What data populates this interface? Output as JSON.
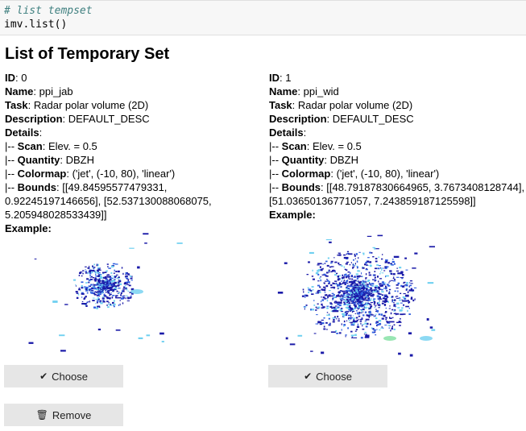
{
  "code": {
    "comment": "# list tempset",
    "call": "imv.list()"
  },
  "heading": "List of Temporary Set",
  "sets": [
    {
      "id_label": "ID",
      "id": "0",
      "name_label": "Name",
      "name": "ppi_jab",
      "task_label": "Task",
      "task": "Radar polar volume (2D)",
      "description_label": "Description",
      "description": "DEFAULT_DESC",
      "details_label": "Details",
      "scan_label": "Scan",
      "scan": "Elev. = 0.5",
      "quantity_label": "Quantity",
      "quantity": "DBZH",
      "colormap_label": "Colormap",
      "colormap": "('jet', (-10, 80), 'linear')",
      "bounds_label": "Bounds",
      "bounds": "[[49.84595577479331, 0.92245197146656], [52.537130088068075, 5.205948028533439]]",
      "example_label": "Example",
      "choose_label": "Choose",
      "choose_icon": "check-icon"
    },
    {
      "id_label": "ID",
      "id": "1",
      "name_label": "Name",
      "name": "ppi_wid",
      "task_label": "Task",
      "task": "Radar polar volume (2D)",
      "description_label": "Description",
      "description": "DEFAULT_DESC",
      "details_label": "Details",
      "scan_label": "Scan",
      "scan": "Elev. = 0.5",
      "quantity_label": "Quantity",
      "quantity": "DBZH",
      "colormap_label": "Colormap",
      "colormap": "('jet', (-10, 80), 'linear')",
      "bounds_label": "Bounds",
      "bounds": "[[48.79187830664965, 3.7673408128744], [51.03650136771057, 7.243859187125598]]",
      "example_label": "Example",
      "choose_label": "Choose",
      "choose_icon": "check-icon"
    }
  ],
  "remove": {
    "label": "Remove",
    "icon": "trash-icon"
  },
  "colors": {
    "radar_dark": "#1a1aa8",
    "radar_mid": "#2f5fe0",
    "radar_light": "#6fd0f0",
    "radar_green": "#7fe0a0"
  }
}
